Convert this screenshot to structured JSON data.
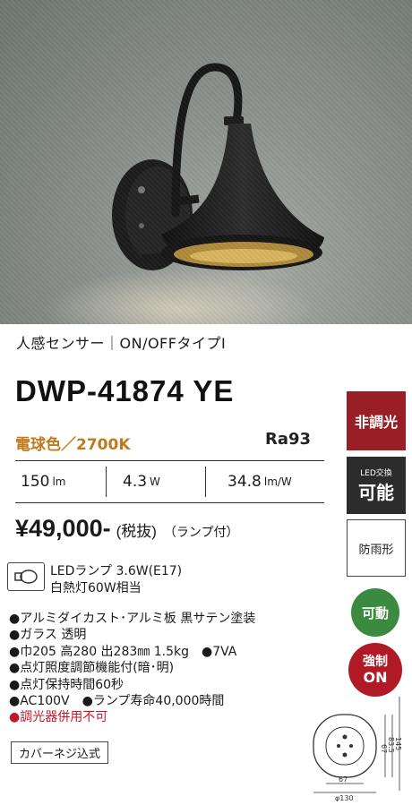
{
  "subtitle": "人感センサー｜ON/OFFタイプⅠ",
  "model": "DWP-41874 YE",
  "color_temp": "電球色／2700K",
  "ra": "Ra93",
  "specs": [
    {
      "value": "150",
      "unit": "lm"
    },
    {
      "value": "4.3",
      "unit": "W"
    },
    {
      "value": "34.8",
      "unit": "lm/W"
    }
  ],
  "price": {
    "amount": "¥49,000-",
    "tax": "(税抜)",
    "lamp": "（ランプ付）"
  },
  "lamp": {
    "line1": "LEDランプ 3.6W(E17)",
    "line2": "白熱灯60W相当"
  },
  "bullets": [
    "●アルミダイカスト･アルミ板 黒サテン塗装",
    "●ガラス 透明",
    "●巾205 高280 出283㎜ 1.5kg　●7VA",
    "●点灯照度調節機能付(暗･明)",
    "●点灯保持時間60秒",
    "●AC100V　●ランプ寿命40,000時間"
  ],
  "warning": "●調光器併用不可",
  "cover": "カバーネジ込式",
  "badges": {
    "dimming": "非調光",
    "led_small": "LED交換",
    "led_large": "可能",
    "rain": "防雨形",
    "movable": "可動",
    "force_a": "強制",
    "force_b": "ON"
  },
  "dimensions": {
    "d1": "67",
    "d2": "83.5",
    "d3": "145",
    "w1": "67",
    "w2": "φ130"
  },
  "colors": {
    "orange": "#c07a1c",
    "dim_red": "#9a1e26",
    "green": "#3a8a3f",
    "red": "#b01a26"
  }
}
